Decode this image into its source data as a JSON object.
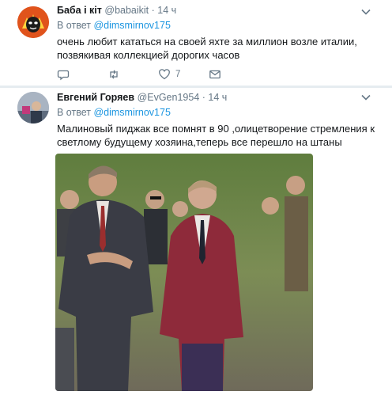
{
  "tweets": [
    {
      "name": "Баба і кіт",
      "handle": "@babaikit",
      "dot": "·",
      "time": "14 ч",
      "reply_prefix": "В ответ",
      "reply_to": "@dimsmirnov175",
      "text": "очень любит кататься на своей яхте за миллион возле италии, позвякивая коллекцией дорогих часов",
      "actions": {
        "likes": "7"
      }
    },
    {
      "name": "Евгений Горяев",
      "handle": "@EvGen1954",
      "dot": "·",
      "time": "14 ч",
      "reply_prefix": "В ответ",
      "reply_to": "@dimsmirnov175",
      "text": "Малиновый пиджак все помнят в 90 ,олицетворение стремления к светлому будущему хозяина,теперь все перешло на штаны"
    }
  ],
  "colors": {
    "accent": "#1b95e0",
    "muted": "#657786",
    "text": "#14171a",
    "border": "#e6ecf0"
  },
  "icons": [
    "chevron-down-icon",
    "reply-icon",
    "retweet-icon",
    "like-icon",
    "message-icon"
  ]
}
